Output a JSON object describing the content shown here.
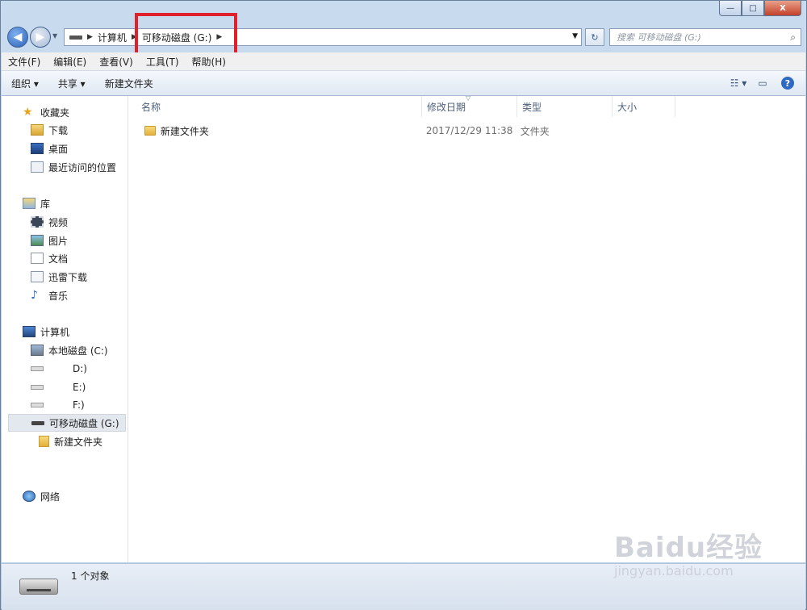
{
  "window": {
    "caption": {
      "minimize": "—",
      "maximize": "□",
      "close": "X"
    }
  },
  "address": {
    "crumbs": [
      "计算机",
      "可移动磁盘 (G:)"
    ],
    "search_placeholder": "搜索 可移动磁盘 (G:)"
  },
  "menu": [
    "文件(F)",
    "编辑(E)",
    "查看(V)",
    "工具(T)",
    "帮助(H)"
  ],
  "toolbar": {
    "organize": "组织 ▾",
    "share": "共享 ▾",
    "new_folder": "新建文件夹"
  },
  "sidebar": {
    "favorites": "收藏夹",
    "fav_items": [
      "下载",
      "桌面",
      "最近访问的位置"
    ],
    "libraries": "库",
    "lib_items": [
      "视频",
      "图片",
      "文档",
      "迅雷下载",
      "音乐"
    ],
    "computer": "计算机",
    "drives": [
      "本地磁盘 (C:)",
      "D:)",
      "E:)",
      "F:)",
      "可移动磁盘 (G:)"
    ],
    "sub_folder": "新建文件夹",
    "network": "网络"
  },
  "columns": [
    "名称",
    "修改日期",
    "类型",
    "大小"
  ],
  "files": [
    {
      "name": "新建文件夹",
      "date": "2017/12/29 11:38",
      "type": "文件夹",
      "size": ""
    }
  ],
  "status": {
    "count": "1 个对象"
  },
  "watermark": {
    "brand": "Baidu经验",
    "url": "jingyan.baidu.com"
  }
}
